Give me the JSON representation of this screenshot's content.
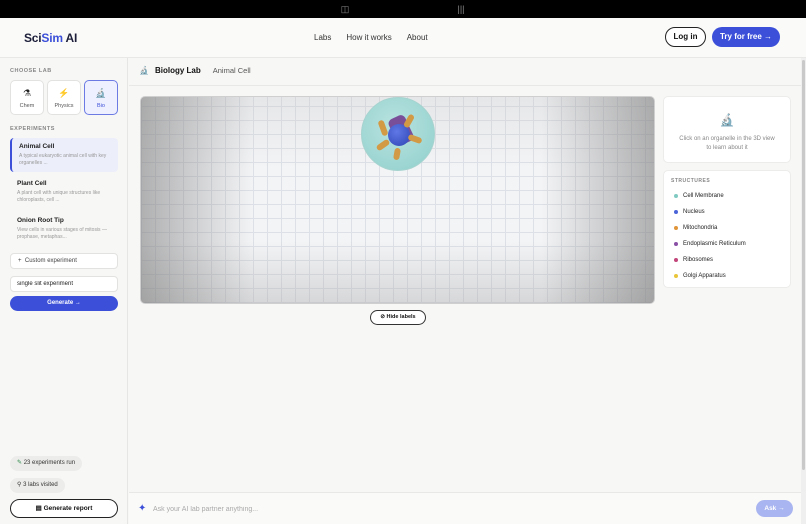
{
  "nav": {
    "logo_main": "Sci",
    "logo_accent": "Sim",
    "logo_suffix": " AI",
    "links": [
      "Labs",
      "How it works",
      "About"
    ],
    "login": "Log in",
    "try": "Try for free →"
  },
  "sidebar": {
    "choose_lab_label": "CHOOSE LAB",
    "labs": [
      {
        "name": "Chem",
        "icon": "flask-icon",
        "glyph": "⚗"
      },
      {
        "name": "Physics",
        "icon": "lightning-icon",
        "glyph": "⚡"
      },
      {
        "name": "Bio",
        "icon": "microscope-icon",
        "glyph": "🔬"
      }
    ],
    "experiments_label": "EXPERIMENTS",
    "experiments": [
      {
        "title": "Animal Cell",
        "desc": "A typical eukaryotic animal cell with key organelles ..."
      },
      {
        "title": "Plant Cell",
        "desc": "A plant cell with unique structures like chloroplasts, cell ..."
      },
      {
        "title": "Onion Root Tip",
        "desc": "View cells in various stages of mitosis — prophase, metaphas..."
      }
    ],
    "custom_label": "Custom experiment",
    "custom_value": "single slit experiment",
    "generate": "Generate →",
    "stat_experiments": "23 experiments run",
    "stat_labs": "3 labs visited",
    "report": "Generate report"
  },
  "main": {
    "lab_title": "Biology Lab",
    "experiment": "Animal Cell",
    "hide_labels": "Hide labels",
    "info_text": "Click on an organelle in the 3D view to learn about it",
    "structures_label": "STRUCTURES",
    "structures": [
      {
        "name": "Cell Membrane",
        "color": "#7fc9c2"
      },
      {
        "name": "Nucleus",
        "color": "#4a63d8"
      },
      {
        "name": "Mitochondria",
        "color": "#e0953a"
      },
      {
        "name": "Endoplasmic Reticulum",
        "color": "#8a4fa6"
      },
      {
        "name": "Ribosomes",
        "color": "#c2447a"
      },
      {
        "name": "Golgi Apparatus",
        "color": "#e9c53a"
      }
    ],
    "chat_placeholder": "Ask your AI lab partner anything...",
    "ask": "Ask →"
  },
  "colors": {
    "accent": "#3b4fd8"
  }
}
